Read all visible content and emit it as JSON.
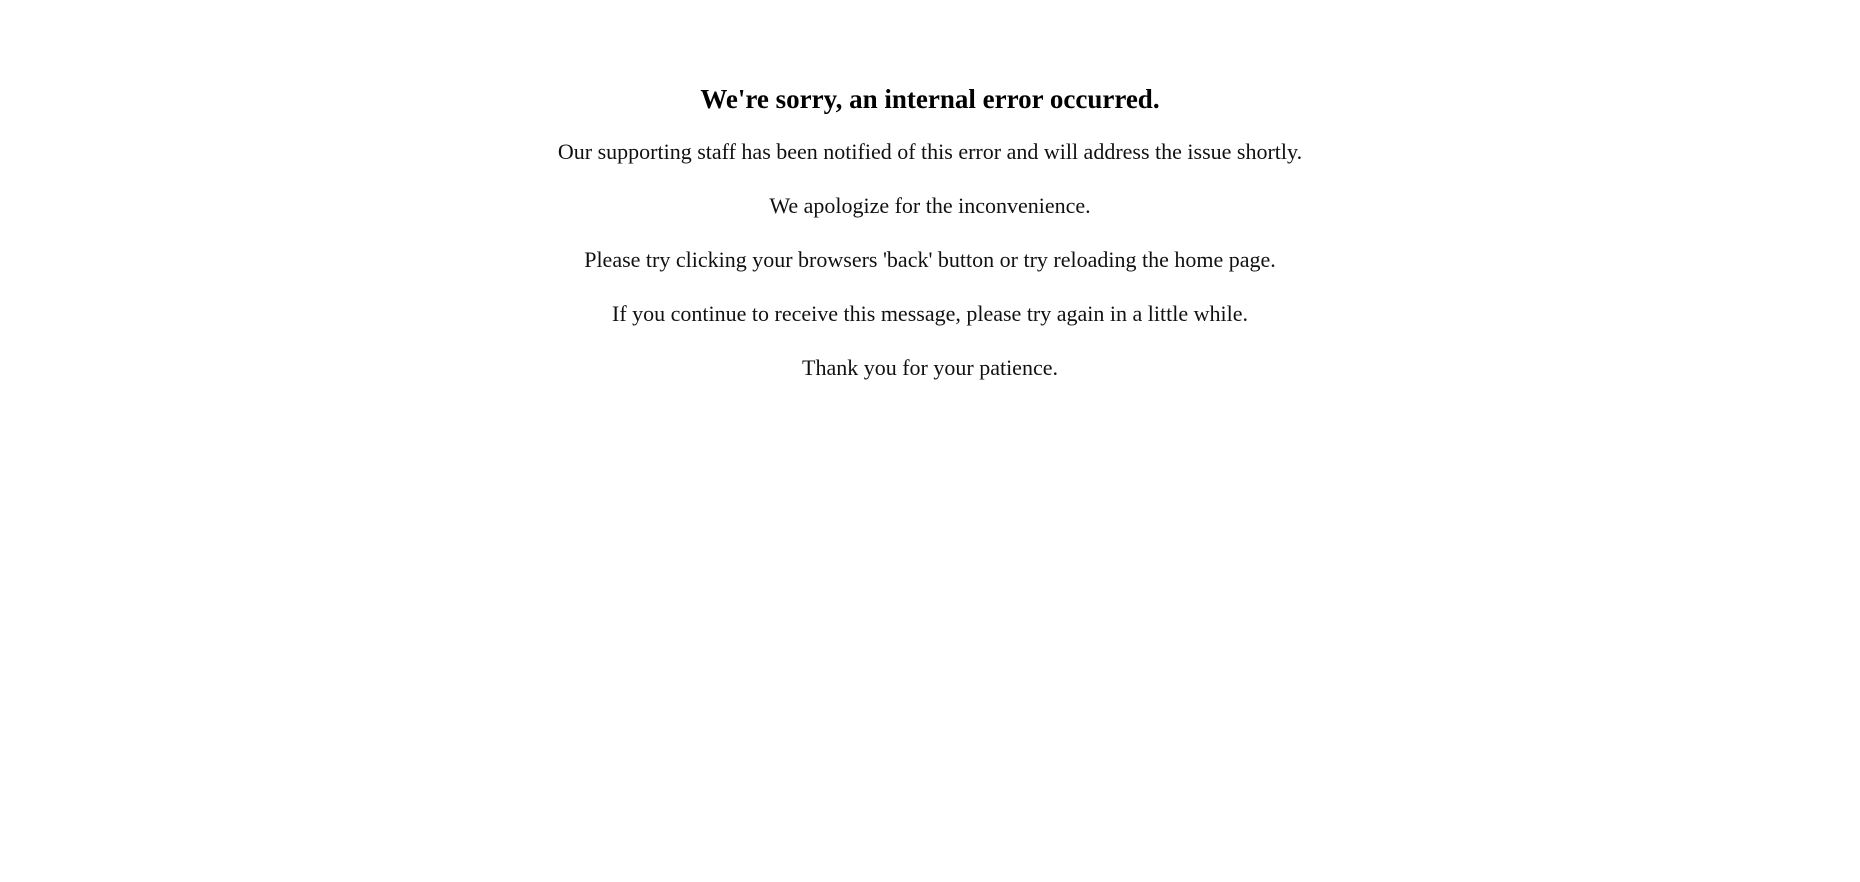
{
  "error_page": {
    "title": "We're sorry, an internal error occurred.",
    "messages": [
      "Our supporting staff has been notified of this error and will address the issue shortly.",
      "We apologize for the inconvenience.",
      "Please try clicking your browsers 'back' button or try reloading the home page.",
      "If you continue to receive this message, please try again in a little while.",
      "Thank you for your patience."
    ]
  }
}
